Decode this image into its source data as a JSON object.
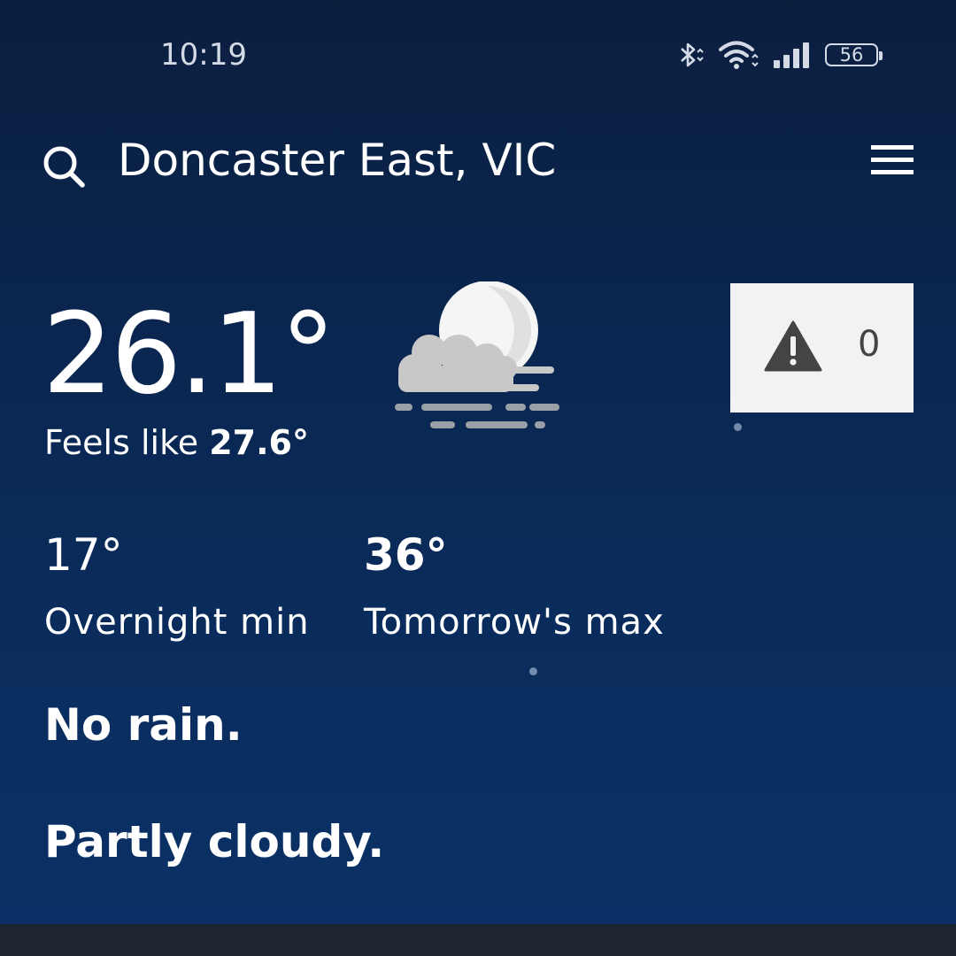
{
  "status_bar": {
    "time": "10:19",
    "battery_level": "56",
    "icons": [
      "bluetooth-icon",
      "wifi-icon",
      "signal-icon",
      "battery-icon"
    ]
  },
  "header": {
    "location": "Doncaster East, VIC",
    "search_icon": "search-icon",
    "menu_icon": "menu-icon"
  },
  "current": {
    "temperature": "26.1°",
    "feels_like_label": "Feels like",
    "feels_like_value": "27.6°",
    "condition_icon": "moon-cloud-fog-icon"
  },
  "warnings": {
    "icon": "warning-icon",
    "count": "0"
  },
  "forecast": {
    "overnight_min_value": "17°",
    "overnight_min_label": "Overnight min",
    "tomorrow_max_value": "36°",
    "tomorrow_max_label": "Tomorrow's max",
    "rain_text": "No rain.",
    "summary_text": "Partly cloudy."
  },
  "colors": {
    "background_top": "#0b1f3f",
    "background_bottom": "#0a3166",
    "warning_box": "#f2f2f4",
    "bottom_bar": "#1c2530"
  }
}
